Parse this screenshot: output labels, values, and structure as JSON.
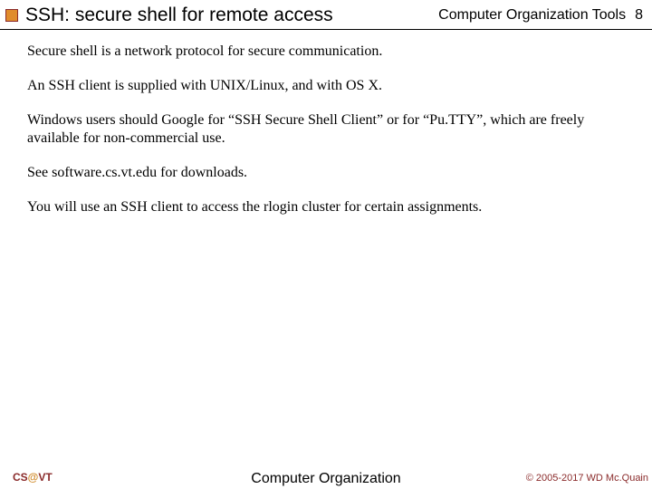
{
  "header": {
    "title": "SSH: secure shell for remote access",
    "course": "Computer Organization Tools",
    "page": "8"
  },
  "body": {
    "p1": "Secure shell is a network protocol for secure communication.",
    "p2": "An SSH client is supplied with UNIX/Linux, and with OS X.",
    "p3": "Windows users should Google for “SSH Secure Shell Client” or for “Pu.TTY”, which are freely available for non-commercial use.",
    "p4": "See software.cs.vt.edu for downloads.",
    "p5": "You will use an SSH client to access the rlogin cluster for certain assignments."
  },
  "footer": {
    "org_cs": "CS",
    "org_at": "@",
    "org_vt": "VT",
    "center": "Computer Organization",
    "copyright": "© 2005-2017 WD Mc.Quain"
  }
}
